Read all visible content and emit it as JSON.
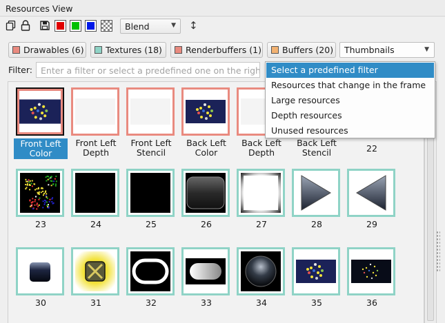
{
  "window": {
    "title": "Resources View"
  },
  "toolbar": {
    "blend_value": "Blend",
    "channel_colors": {
      "red": "#e00000",
      "green": "#00c000",
      "blue": "#0018e8"
    },
    "icons": [
      "copy-icon",
      "lock-icon",
      "save-icon",
      "red-channel-icon",
      "green-channel-icon",
      "blue-channel-icon",
      "alpha-checker-icon",
      "flip-vertical-icon"
    ]
  },
  "categories": [
    {
      "label": "Drawables (6)",
      "color": "#e98a7f"
    },
    {
      "label": "Textures (18)",
      "color": "#8fd3c6"
    },
    {
      "label": "Renderbuffers (1)",
      "color": "#e98a7f"
    },
    {
      "label": "Buffers (20)",
      "color": "#f2b272"
    }
  ],
  "view_mode": "Thumbnails",
  "filter": {
    "label": "Filter:",
    "placeholder": "Enter a filter or select a predefined one on the right"
  },
  "filter_menu": {
    "items": [
      "Select a predefined filter",
      "Resources that change in the frame",
      "Large resources",
      "Depth resources",
      "Unused resources"
    ],
    "highlighted": 0
  },
  "resources": [
    {
      "label": "Front Left Color",
      "kind": "drawable",
      "preview": "scene",
      "selected": true
    },
    {
      "label": "Front Left Depth",
      "kind": "drawable",
      "preview": "blank"
    },
    {
      "label": "Front Left Stencil",
      "kind": "drawable",
      "preview": "blank"
    },
    {
      "label": "Back Left Color",
      "kind": "drawable",
      "preview": "scene"
    },
    {
      "label": "Back Left Depth",
      "kind": "drawable",
      "preview": "blank"
    },
    {
      "label": "Back Left Stencil",
      "kind": "drawable",
      "preview": "blank"
    },
    {
      "label": "22",
      "kind": "texture",
      "preview": "none"
    },
    {
      "label": "23",
      "kind": "texture",
      "preview": "noise"
    },
    {
      "label": "24",
      "kind": "texture",
      "preview": "black"
    },
    {
      "label": "25",
      "kind": "texture",
      "preview": "black"
    },
    {
      "label": "26",
      "kind": "texture",
      "preview": "rounded-bar"
    },
    {
      "label": "27",
      "kind": "texture",
      "preview": "glow-square"
    },
    {
      "label": "28",
      "kind": "texture",
      "preview": "arrow-right"
    },
    {
      "label": "29",
      "kind": "texture",
      "preview": "arrow-left"
    },
    {
      "label": "30",
      "kind": "texture",
      "preview": "button-dark"
    },
    {
      "label": "31",
      "kind": "texture",
      "preview": "close-x"
    },
    {
      "label": "32",
      "kind": "texture",
      "preview": "ring-pill"
    },
    {
      "label": "33",
      "kind": "texture",
      "preview": "soft-pill"
    },
    {
      "label": "34",
      "kind": "texture",
      "preview": "sphere"
    },
    {
      "label": "35",
      "kind": "texture",
      "preview": "scene"
    },
    {
      "label": "36",
      "kind": "texture",
      "preview": "scene-dark"
    }
  ]
}
